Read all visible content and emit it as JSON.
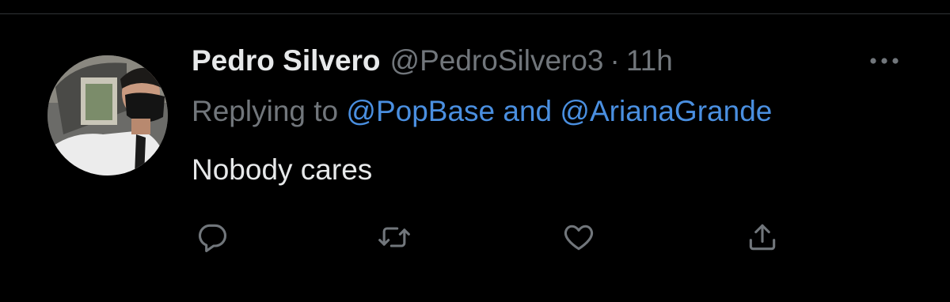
{
  "tweet": {
    "display_name": "Pedro Silvero",
    "handle": "@PedroSilvero3",
    "separator": "·",
    "timestamp": "11h",
    "replying_to_prefix": "Replying to",
    "mention_1": "@PopBase",
    "conjunction": "and",
    "mention_2": "@ArianaGrande",
    "text": "Nobody cares"
  },
  "icons": {
    "more": "more-options-icon",
    "reply": "reply-icon",
    "retweet": "retweet-icon",
    "like": "heart-icon",
    "share": "share-icon"
  },
  "colors": {
    "background": "#000000",
    "primary_text": "#e7e9ea",
    "secondary_text": "#71767b",
    "link": "#4a8fe0",
    "icon": "#71767b"
  }
}
